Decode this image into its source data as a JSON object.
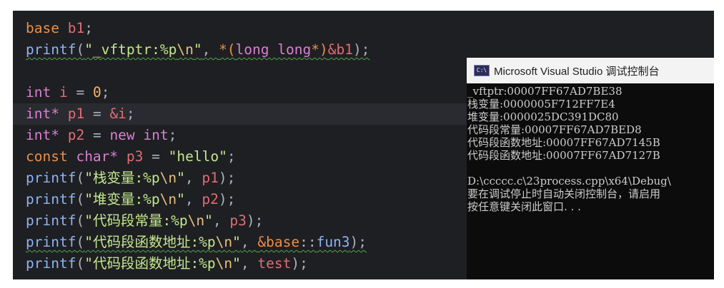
{
  "editor": {
    "lines": [
      {
        "tokens": [
          {
            "t": "base",
            "c": "kw"
          },
          {
            "t": " ",
            "c": "punc"
          },
          {
            "t": "b1",
            "c": "var"
          },
          {
            "t": ";",
            "c": "punc"
          }
        ]
      },
      {
        "underline": true,
        "tokens": [
          {
            "t": "printf",
            "c": "fn"
          },
          {
            "t": "(",
            "c": "punc"
          },
          {
            "t": "\"_vftptr:%p",
            "c": "str"
          },
          {
            "t": "\\n",
            "c": "esc"
          },
          {
            "t": "\"",
            "c": "str"
          },
          {
            "t": ", ",
            "c": "punc"
          },
          {
            "t": "*(",
            "c": "kw"
          },
          {
            "t": "long long",
            "c": "type"
          },
          {
            "t": "*)",
            "c": "kw"
          },
          {
            "t": "&b1",
            "c": "var"
          },
          {
            "t": ");",
            "c": "punc"
          }
        ]
      },
      {
        "tokens": []
      },
      {
        "tokens": [
          {
            "t": "int",
            "c": "type"
          },
          {
            "t": " ",
            "c": "punc"
          },
          {
            "t": "i",
            "c": "var"
          },
          {
            "t": " = ",
            "c": "punc"
          },
          {
            "t": "0",
            "c": "num"
          },
          {
            "t": ";",
            "c": "punc"
          }
        ]
      },
      {
        "current": true,
        "tokens": [
          {
            "t": "int*",
            "c": "type"
          },
          {
            "t": " ",
            "c": "punc"
          },
          {
            "t": "p1",
            "c": "var"
          },
          {
            "t": " = ",
            "c": "punc"
          },
          {
            "t": "&i",
            "c": "var"
          },
          {
            "t": ";",
            "c": "punc"
          }
        ]
      },
      {
        "tokens": [
          {
            "t": "int*",
            "c": "type"
          },
          {
            "t": " ",
            "c": "punc"
          },
          {
            "t": "p2",
            "c": "var"
          },
          {
            "t": " = ",
            "c": "punc"
          },
          {
            "t": "new",
            "c": "type"
          },
          {
            "t": " ",
            "c": "punc"
          },
          {
            "t": "int",
            "c": "type"
          },
          {
            "t": ";",
            "c": "punc"
          }
        ]
      },
      {
        "tokens": [
          {
            "t": "const",
            "c": "kw"
          },
          {
            "t": " ",
            "c": "punc"
          },
          {
            "t": "char*",
            "c": "type"
          },
          {
            "t": " ",
            "c": "punc"
          },
          {
            "t": "p3",
            "c": "var"
          },
          {
            "t": " = ",
            "c": "punc"
          },
          {
            "t": "\"hello\"",
            "c": "str"
          },
          {
            "t": ";",
            "c": "punc"
          }
        ]
      },
      {
        "tokens": [
          {
            "t": "printf",
            "c": "fn"
          },
          {
            "t": "(",
            "c": "punc"
          },
          {
            "t": "\"栈变量:%p",
            "c": "str"
          },
          {
            "t": "\\n",
            "c": "esc"
          },
          {
            "t": "\"",
            "c": "str"
          },
          {
            "t": ", ",
            "c": "punc"
          },
          {
            "t": "p1",
            "c": "var"
          },
          {
            "t": ");",
            "c": "punc"
          }
        ]
      },
      {
        "tokens": [
          {
            "t": "printf",
            "c": "fn"
          },
          {
            "t": "(",
            "c": "punc"
          },
          {
            "t": "\"堆变量:%p",
            "c": "str"
          },
          {
            "t": "\\n",
            "c": "esc"
          },
          {
            "t": "\"",
            "c": "str"
          },
          {
            "t": ", ",
            "c": "punc"
          },
          {
            "t": "p2",
            "c": "var"
          },
          {
            "t": ");",
            "c": "punc"
          }
        ]
      },
      {
        "tokens": [
          {
            "t": "printf",
            "c": "fn"
          },
          {
            "t": "(",
            "c": "punc"
          },
          {
            "t": "\"代码段常量:%p",
            "c": "str"
          },
          {
            "t": "\\n",
            "c": "esc"
          },
          {
            "t": "\"",
            "c": "str"
          },
          {
            "t": ", ",
            "c": "punc"
          },
          {
            "t": "p3",
            "c": "var"
          },
          {
            "t": ");",
            "c": "punc"
          }
        ]
      },
      {
        "underline": true,
        "tokens": [
          {
            "t": "printf",
            "c": "fn"
          },
          {
            "t": "(",
            "c": "punc"
          },
          {
            "t": "\"代码段函数地址:%p",
            "c": "str"
          },
          {
            "t": "\\n",
            "c": "esc"
          },
          {
            "t": "\"",
            "c": "str"
          },
          {
            "t": ", ",
            "c": "punc"
          },
          {
            "t": "&base",
            "c": "kw"
          },
          {
            "t": "::",
            "c": "punc"
          },
          {
            "t": "fun3",
            "c": "fn"
          },
          {
            "t": ");",
            "c": "punc"
          }
        ]
      },
      {
        "tokens": [
          {
            "t": "printf",
            "c": "fn"
          },
          {
            "t": "(",
            "c": "punc"
          },
          {
            "t": "\"代码段函数地址:%p",
            "c": "str"
          },
          {
            "t": "\\n",
            "c": "esc"
          },
          {
            "t": "\"",
            "c": "str"
          },
          {
            "t": ", ",
            "c": "punc"
          },
          {
            "t": "test",
            "c": "var"
          },
          {
            "t": ");",
            "c": "punc"
          }
        ]
      }
    ]
  },
  "console": {
    "icon_name": "console-app-icon",
    "icon_text": "C:\\",
    "title": "Microsoft Visual Studio 调试控制台",
    "lines": [
      "_vftptr:00007FF67AD7BE38",
      "栈变量:0000005F712FF7E4",
      "堆变量:0000025DC391DC80",
      "代码段常量:00007FF67AD7BED8",
      "代码段函数地址:00007FF67AD7145B",
      "代码段函数地址:00007FF67AD7127B",
      "",
      "D:\\ccccc.c\\23process.cpp\\x64\\Debug\\",
      "要在调试停止时自动关闭控制台，请启用",
      "按任意键关闭此窗口. . ."
    ]
  }
}
